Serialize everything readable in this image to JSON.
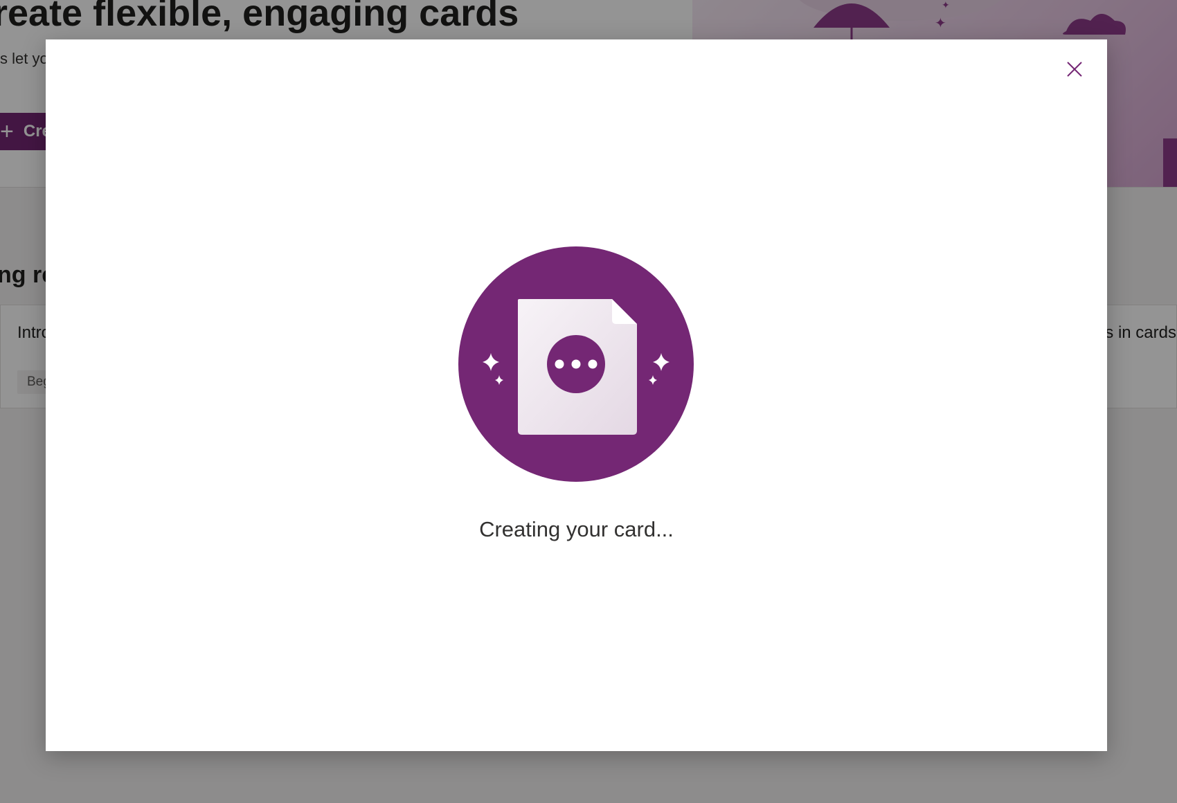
{
  "background": {
    "hero_title": "reate flexible, engaging cards",
    "hero_subtitle": "s let yo",
    "create_button_label": "Cre",
    "section_title": "ng re",
    "left_card_title": "Intro",
    "left_card_badge": "Beg",
    "right_card_title": "rs in cards"
  },
  "modal": {
    "status_text": "Creating your card...",
    "close_icon": "close-icon",
    "illustration_icon": "document-loading-icon"
  },
  "colors": {
    "accent": "#742774",
    "overlay": "rgba(0,0,0,0.42)",
    "text_primary": "#323130"
  }
}
